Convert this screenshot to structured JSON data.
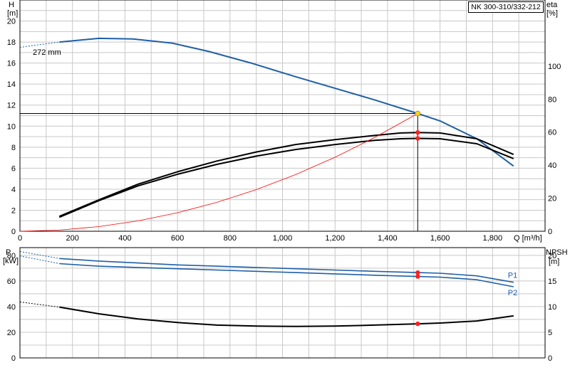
{
  "chart_data": [
    {
      "type": "line",
      "title": "NK 300-310/332-212",
      "xlabel": "Q [m³/h]",
      "x_unit_label": "Q [m³/h]",
      "xlim": [
        0,
        2000
      ],
      "x_ticks": [
        0,
        200,
        400,
        600,
        800,
        1000,
        1200,
        1400,
        1600,
        1800
      ],
      "x_tick_labels": [
        "0",
        "200",
        "400",
        "600",
        "800",
        "1,000",
        "1,200",
        "1,400",
        "1,600",
        "1,800"
      ],
      "y_left": {
        "label_top": "H",
        "label_unit": "[m]",
        "lim": [
          0,
          22
        ],
        "ticks": [
          0,
          2,
          4,
          6,
          8,
          10,
          12,
          14,
          16,
          18,
          20
        ]
      },
      "y_right": {
        "label_top": "eta",
        "label_unit": "[%]",
        "lim": [
          0,
          140
        ],
        "ticks": [
          0,
          20,
          40,
          60,
          80,
          100
        ]
      },
      "impeller_label": "272 mm",
      "duty_point": {
        "Q": 1515,
        "H": 11.2
      },
      "series": [
        {
          "key": "head",
          "axis": "left",
          "color": "#1f5fa6",
          "x": [
            150,
            300,
            430,
            580,
            720,
            880,
            1050,
            1200,
            1350,
            1515,
            1600,
            1740,
            1880
          ],
          "y": [
            18.0,
            18.35,
            18.3,
            17.9,
            17.1,
            16.0,
            14.7,
            13.6,
            12.5,
            11.2,
            10.5,
            8.8,
            6.2
          ],
          "dashed_extension": {
            "x": [
              0,
              150
            ],
            "y": [
              17.5,
              18.0
            ]
          }
        },
        {
          "key": "eta_upper",
          "axis": "right",
          "color": "#000000",
          "x": [
            150,
            300,
            450,
            600,
            750,
            900,
            1050,
            1200,
            1350,
            1450,
            1515,
            1600,
            1740,
            1880
          ],
          "y": [
            9,
            19,
            28.5,
            36,
            42.5,
            48,
            52.5,
            55.5,
            58,
            59.5,
            59.8,
            59.5,
            56,
            46.5
          ]
        },
        {
          "key": "eta_lower",
          "axis": "right",
          "color": "#000000",
          "x": [
            150,
            300,
            450,
            600,
            750,
            900,
            1050,
            1200,
            1350,
            1450,
            1515,
            1600,
            1740,
            1880
          ],
          "y": [
            8.5,
            18.5,
            27.5,
            34.5,
            40.5,
            45.5,
            49.5,
            52.5,
            55,
            56,
            56.2,
            56,
            53,
            44
          ]
        },
        {
          "key": "system_curve",
          "axis": "left",
          "color": "#ff0000",
          "x": [
            0,
            150,
            300,
            450,
            600,
            750,
            900,
            1050,
            1200,
            1350,
            1515
          ],
          "y": [
            0,
            0.11,
            0.44,
            0.99,
            1.76,
            2.75,
            3.96,
            5.39,
            7.04,
            8.91,
            11.2
          ]
        }
      ],
      "eta_points": [
        {
          "Q": 1515,
          "eta": 59.8
        },
        {
          "Q": 1515,
          "eta": 56.2
        }
      ]
    },
    {
      "type": "line",
      "xlim": [
        0,
        2000
      ],
      "y_left": {
        "label_top": "P",
        "label_unit": "[kW]",
        "lim": [
          0,
          86
        ],
        "ticks": [
          0,
          20,
          40,
          60,
          80
        ]
      },
      "y_right": {
        "label_top": "NPSH",
        "label_unit": "[m]",
        "lim": [
          0,
          21.5
        ],
        "ticks": [
          0,
          5,
          10,
          15,
          20
        ]
      },
      "series": [
        {
          "name": "P1",
          "axis": "left",
          "color": "#1f5fa6",
          "x": [
            150,
            300,
            450,
            600,
            750,
            900,
            1050,
            1200,
            1350,
            1515,
            1600,
            1740,
            1880
          ],
          "y": [
            77.5,
            75.5,
            74,
            72.5,
            71.5,
            70.5,
            69.5,
            68.5,
            67.5,
            66.5,
            66,
            64,
            59
          ],
          "dashed_extension": {
            "x": [
              0,
              150
            ],
            "y": [
              83,
              77.5
            ]
          }
        },
        {
          "name": "P2",
          "axis": "left",
          "color": "#1f5fa6",
          "x": [
            150,
            300,
            450,
            600,
            750,
            900,
            1050,
            1200,
            1350,
            1515,
            1600,
            1740,
            1880
          ],
          "y": [
            73.5,
            71.5,
            70.5,
            69.5,
            68.5,
            67.5,
            66.5,
            65.5,
            64.5,
            63.5,
            63,
            61,
            55.5
          ],
          "dashed_extension": {
            "x": [
              0,
              150
            ],
            "y": [
              79.5,
              73.5
            ]
          }
        },
        {
          "key": "npsh",
          "axis": "right",
          "color": "#000000",
          "x": [
            150,
            300,
            450,
            600,
            750,
            900,
            1050,
            1200,
            1350,
            1515,
            1600,
            1740,
            1880
          ],
          "y": [
            9.9,
            8.6,
            7.6,
            6.9,
            6.4,
            6.2,
            6.15,
            6.2,
            6.4,
            6.65,
            6.8,
            7.2,
            8.2
          ],
          "dashed_extension": {
            "x": [
              0,
              150
            ],
            "y": [
              10.9,
              9.9
            ]
          }
        }
      ],
      "duty_points": [
        {
          "Q": 1515,
          "P": 66.5
        },
        {
          "Q": 1515,
          "P": 63.5
        },
        {
          "Q": 1515,
          "NPSH": 6.65
        }
      ]
    }
  ]
}
